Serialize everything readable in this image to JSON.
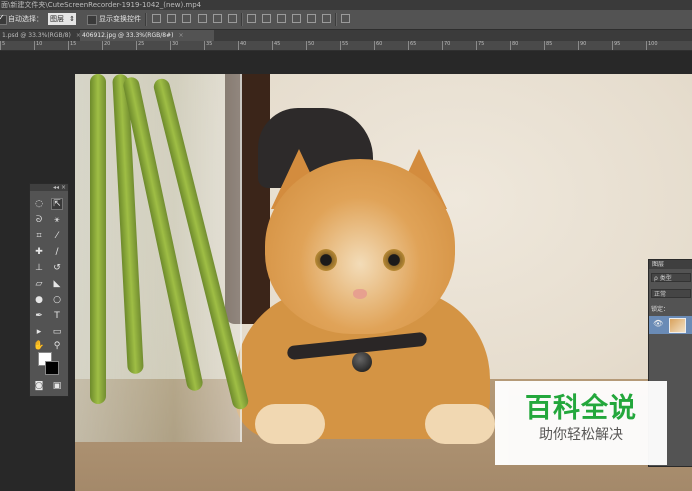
{
  "window": {
    "title": "面\\新建文件夹\\CuteScreenRecorder-1919-1042_(new).mp4"
  },
  "options_bar": {
    "auto_select_label": "自动选择：",
    "auto_select_checked": true,
    "auto_select_value": "图层",
    "show_transform_label": "显示变换控件",
    "show_transform_checked": false
  },
  "tabs": [
    {
      "label": "1.psd @ 33.3%(RGB/8)",
      "close": "×",
      "active": false
    },
    {
      "label": "406912.jpg @ 33.3%(RGB/8#)",
      "close": "×",
      "active": true
    }
  ],
  "ruler": {
    "ticks": [
      "5",
      "10",
      "15",
      "20",
      "25",
      "30",
      "35",
      "40",
      "45",
      "50",
      "55",
      "60",
      "65",
      "70",
      "75",
      "80",
      "85",
      "90",
      "95",
      "100"
    ]
  },
  "tools_panel": {
    "header": "◂◂ ×",
    "icons": [
      "marquee-icon",
      "move-icon",
      "lasso-icon",
      "magic-wand-icon",
      "crop-icon",
      "eyedropper-icon",
      "healing-icon",
      "brush-icon",
      "stamp-icon",
      "history-brush-icon",
      "eraser-icon",
      "gradient-icon",
      "blur-icon",
      "dodge-icon",
      "pen-icon",
      "text-icon",
      "path-select-icon",
      "shape-icon",
      "hand-icon",
      "zoom-icon"
    ]
  },
  "layers_panel": {
    "title": "图层",
    "filter_label": "ρ 类型",
    "blend_mode": "正常",
    "lock_label": "锁定：",
    "layer_visible": "👁"
  },
  "watermark": {
    "title": "百科全说",
    "subtitle": "助你轻松解决"
  },
  "colors": {
    "canvas_bg": "#282828",
    "panel_bg": "#535353",
    "watermark_green": "#1ea83a"
  }
}
